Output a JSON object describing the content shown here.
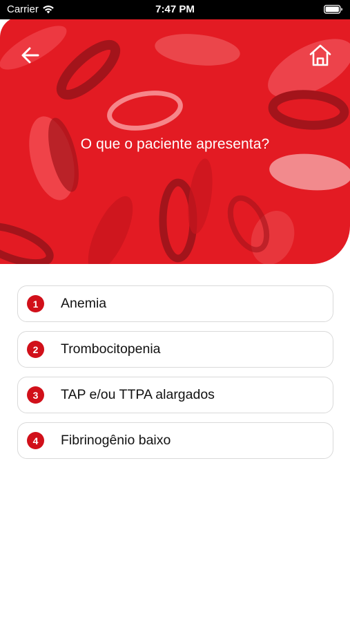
{
  "status_bar": {
    "carrier": "Carrier",
    "time": "7:47 PM"
  },
  "header": {
    "title": "O que o paciente apresenta?",
    "back_icon": "arrow-left-icon",
    "home_icon": "home-icon",
    "background_color": "#e31b23"
  },
  "options": [
    {
      "number": "1",
      "label": "Anemia"
    },
    {
      "number": "2",
      "label": "Trombocitopenia"
    },
    {
      "number": "3",
      "label": "TAP e/ou TTPA alargados"
    },
    {
      "number": "4",
      "label": "Fibrinogênio baixo"
    }
  ],
  "colors": {
    "accent": "#d1101a",
    "border": "#d9d9d9"
  }
}
